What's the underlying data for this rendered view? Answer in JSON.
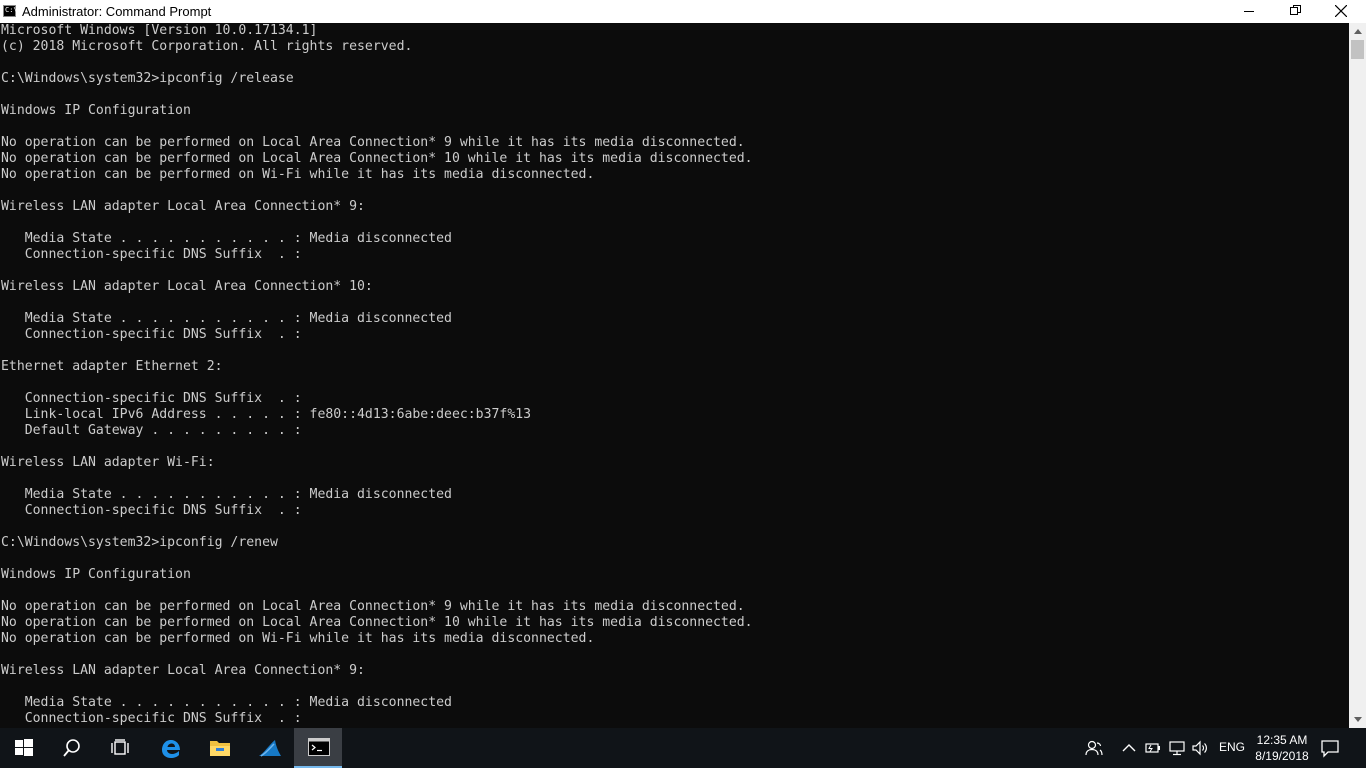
{
  "window": {
    "title": "Administrator: Command Prompt",
    "icon": "cmd-icon",
    "icon_glyph": "C:\\"
  },
  "console": {
    "lines": [
      "Microsoft Windows [Version 10.0.17134.1]",
      "(c) 2018 Microsoft Corporation. All rights reserved.",
      "",
      "C:\\Windows\\system32>ipconfig /release",
      "",
      "Windows IP Configuration",
      "",
      "No operation can be performed on Local Area Connection* 9 while it has its media disconnected.",
      "No operation can be performed on Local Area Connection* 10 while it has its media disconnected.",
      "No operation can be performed on Wi-Fi while it has its media disconnected.",
      "",
      "Wireless LAN adapter Local Area Connection* 9:",
      "",
      "   Media State . . . . . . . . . . . : Media disconnected",
      "   Connection-specific DNS Suffix  . :",
      "",
      "Wireless LAN adapter Local Area Connection* 10:",
      "",
      "   Media State . . . . . . . . . . . : Media disconnected",
      "   Connection-specific DNS Suffix  . :",
      "",
      "Ethernet adapter Ethernet 2:",
      "",
      "   Connection-specific DNS Suffix  . :",
      "   Link-local IPv6 Address . . . . . : fe80::4d13:6abe:deec:b37f%13",
      "   Default Gateway . . . . . . . . . :",
      "",
      "Wireless LAN adapter Wi-Fi:",
      "",
      "   Media State . . . . . . . . . . . : Media disconnected",
      "   Connection-specific DNS Suffix  . :",
      "",
      "C:\\Windows\\system32>ipconfig /renew",
      "",
      "Windows IP Configuration",
      "",
      "No operation can be performed on Local Area Connection* 9 while it has its media disconnected.",
      "No operation can be performed on Local Area Connection* 10 while it has its media disconnected.",
      "No operation can be performed on Wi-Fi while it has its media disconnected.",
      "",
      "Wireless LAN adapter Local Area Connection* 9:",
      "",
      "   Media State . . . . . . . . . . . : Media disconnected",
      "   Connection-specific DNS Suffix  . :"
    ]
  },
  "taskbar": {
    "apps": [
      "start-icon",
      "search-icon",
      "task-view-icon",
      "edge-icon",
      "file-explorer-icon",
      "wireshark-icon",
      "command-prompt-icon"
    ],
    "active_app": "command-prompt-icon",
    "tray": {
      "icons": [
        "people-icon",
        "chevron-up-icon",
        "battery-icon",
        "network-icon",
        "volume-icon"
      ],
      "language": "ENG",
      "time": "12:35 AM",
      "date": "8/19/2018"
    }
  },
  "colors": {
    "console_bg": "#0c0c0c",
    "console_text": "#cccccc",
    "titlebar_bg": "#ffffff",
    "taskbar_bg": "#101418",
    "accent": "#76b9ed"
  }
}
